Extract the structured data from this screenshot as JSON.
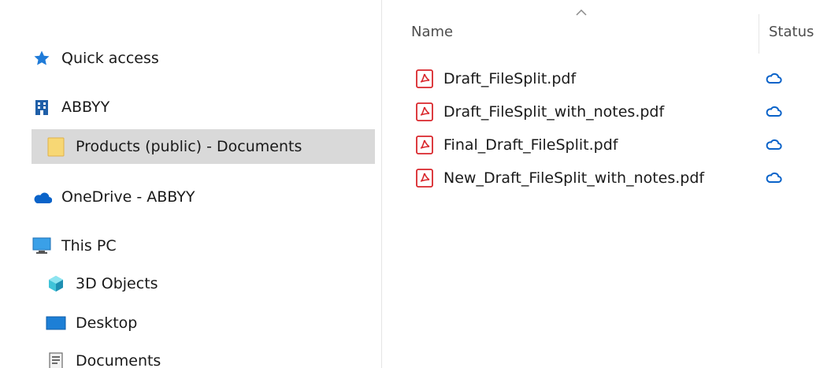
{
  "nav": {
    "items": [
      {
        "label": "Quick access",
        "icon": "star-icon"
      },
      {
        "label": "ABBYY",
        "icon": "building-icon"
      },
      {
        "label": "Products (public) - Documents",
        "icon": "folder-icon",
        "selected": true
      },
      {
        "label": "OneDrive - ABBYY",
        "icon": "onedrive-cloud-icon"
      },
      {
        "label": "This PC",
        "icon": "monitor-icon"
      },
      {
        "label": "3D Objects",
        "icon": "3d-objects-icon"
      },
      {
        "label": "Desktop",
        "icon": "desktop-icon"
      },
      {
        "label": "Documents",
        "icon": "documents-icon"
      }
    ]
  },
  "columns": {
    "name": "Name",
    "status": "Status"
  },
  "files": [
    {
      "name": "Draft_FileSplit.pdf",
      "icon": "pdf-file-icon",
      "status_icon": "cloud-icon"
    },
    {
      "name": "Draft_FileSplit_with_notes.pdf",
      "icon": "pdf-file-icon",
      "status_icon": "cloud-icon"
    },
    {
      "name": "Final_Draft_FileSplit.pdf",
      "icon": "pdf-file-icon",
      "status_icon": "cloud-icon"
    },
    {
      "name": "New_Draft_FileSplit_with_notes.pdf",
      "icon": "pdf-file-icon",
      "status_icon": "cloud-icon"
    }
  ],
  "colors": {
    "selection": "#d9d9d9",
    "accent_blue": "#0a63c9",
    "pdf_red": "#d9262b"
  }
}
